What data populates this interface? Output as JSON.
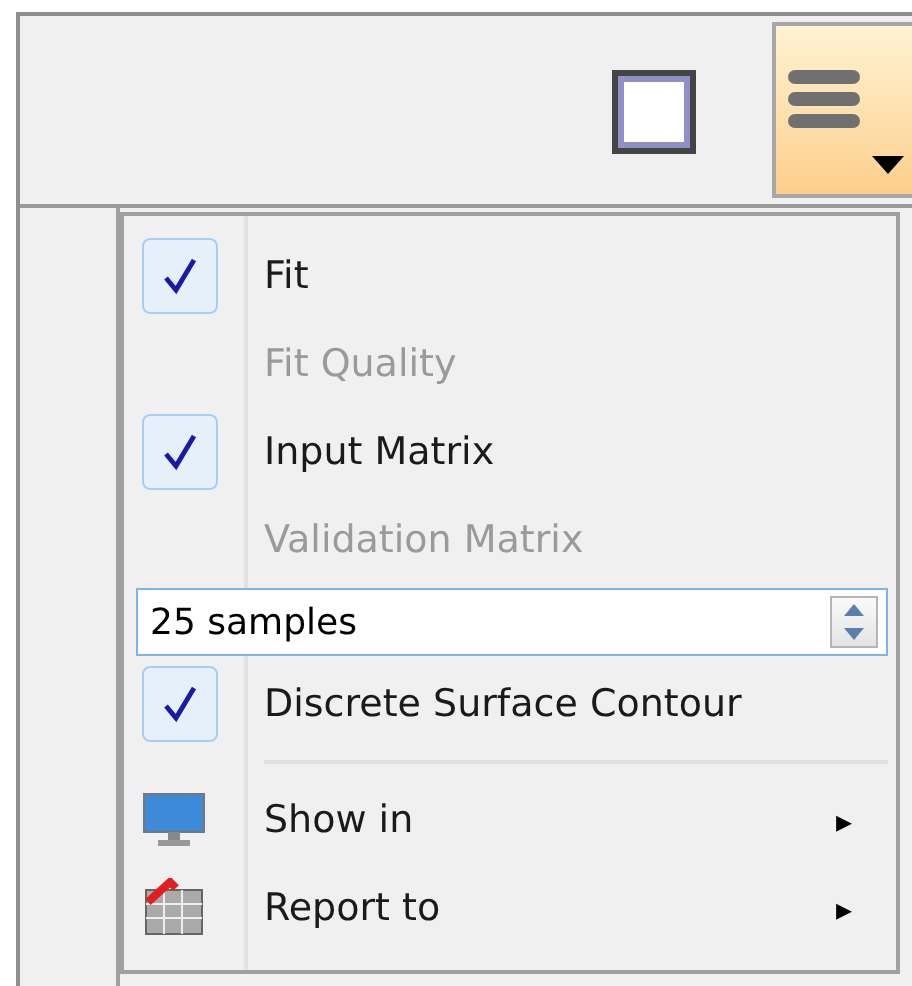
{
  "toolbar": {
    "square_button": {
      "selected": false
    },
    "menu_button": {
      "selected": true
    }
  },
  "menu": {
    "items": [
      {
        "kind": "check",
        "label": "Fit",
        "checked": true,
        "disabled": false
      },
      {
        "kind": "check",
        "label": "Fit Quality",
        "checked": false,
        "disabled": true
      },
      {
        "kind": "check",
        "label": "Input Matrix",
        "checked": true,
        "disabled": false
      },
      {
        "kind": "check",
        "label": "Validation Matrix",
        "checked": false,
        "disabled": true
      },
      {
        "kind": "spinner",
        "value": "25 samples"
      },
      {
        "kind": "check",
        "label": "Discrete Surface Contour",
        "checked": true,
        "disabled": false
      },
      {
        "kind": "separator"
      },
      {
        "kind": "submenu",
        "label": "Show in",
        "arrow": "▸"
      },
      {
        "kind": "submenu",
        "label": "Report to",
        "arrow": "▸"
      }
    ]
  }
}
